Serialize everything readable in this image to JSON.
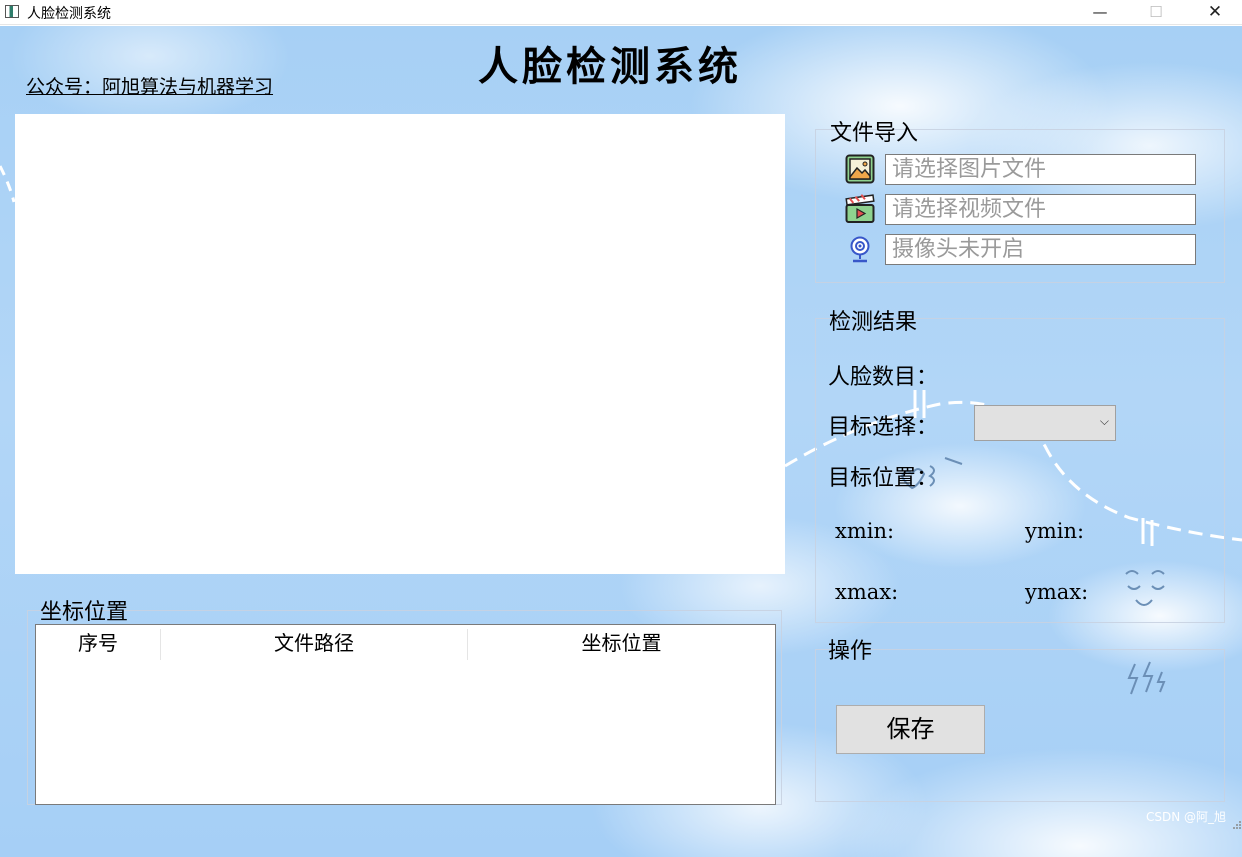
{
  "window": {
    "title": "人脸检测系统",
    "minimize": "—",
    "maximize": "☐",
    "close": "✕"
  },
  "header": {
    "title": "人脸检测系统",
    "wechat": "公众号：阿旭算法与机器学习"
  },
  "coordinates_panel": {
    "title": "坐标位置",
    "columns": [
      "序号",
      "文件路径",
      "坐标位置"
    ]
  },
  "file_import": {
    "title": "文件导入",
    "image_placeholder": "请选择图片文件",
    "video_placeholder": "请选择视频文件",
    "camera_placeholder": "摄像头未开启"
  },
  "detection_result": {
    "title": "检测结果",
    "face_count_label": "人脸数目：",
    "target_select_label": "目标选择：",
    "target_select_value": "",
    "target_position_label": "目标位置：",
    "xmin_label": "xmin:",
    "ymin_label": "ymin:",
    "xmax_label": "xmax:",
    "ymax_label": "ymax:"
  },
  "operations": {
    "title": "操作",
    "save_label": "保存"
  },
  "watermark": "CSDN @阿_旭",
  "colors": {
    "background": "#a7d0f5",
    "panel": "#ffffff",
    "button": "#e1e1e1"
  }
}
